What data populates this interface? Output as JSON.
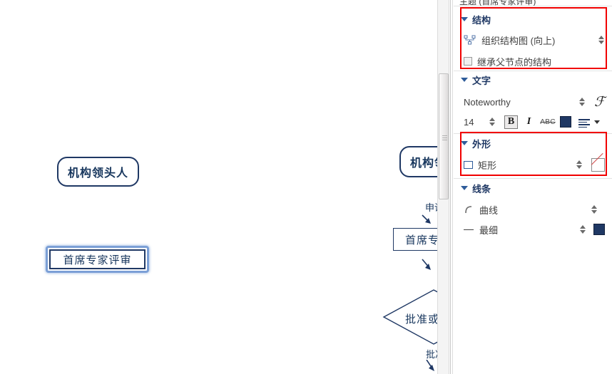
{
  "window": {
    "cut_off_header": "主题 (首席专家评审)"
  },
  "canvas": {
    "nodes": [
      {
        "id": "leader",
        "label": "机构领头人",
        "shape": "rounded-rect"
      },
      {
        "id": "leader2",
        "label": "机构领头人",
        "shape": "rounded-rect",
        "clipped": true
      },
      {
        "id": "chief-review-selected",
        "label": "首席专家评审",
        "shape": "rect",
        "selected": true
      },
      {
        "id": "chief-review",
        "label": "首席专家评审",
        "shape": "rect",
        "clipped": true
      },
      {
        "id": "approve",
        "label": "批准或驳回",
        "shape": "diamond",
        "clipped": true
      }
    ],
    "edge_labels": [
      {
        "id": "apply",
        "label": "申请"
      },
      {
        "id": "approve-result",
        "label": "批准"
      }
    ]
  },
  "scrollbar": {
    "name": "vertical-scrollbar",
    "orientation": "vertical"
  },
  "inspector": {
    "structure": {
      "title": "结构",
      "type_value": "组织结构图 (向上)",
      "type_icon": "org-chart-icon",
      "inherit_checkbox_label": "继承父节点的结构",
      "inherit_checked": false
    },
    "text": {
      "title": "文字",
      "font_family": "Noteworthy",
      "font_size": "14",
      "bold_label": "B",
      "italic_label": "I",
      "strike_label": "ABC",
      "color": "#1f3864",
      "bold_active": true,
      "fx_label": "ℱ"
    },
    "shape": {
      "title": "外形",
      "shape_value": "矩形",
      "fill": "none"
    },
    "line": {
      "title": "线条",
      "style_value": "曲线",
      "width_value": "最细",
      "color": "#1f3864"
    }
  },
  "highlights": [
    {
      "name": "structure-highlight"
    },
    {
      "name": "shape-highlight"
    }
  ],
  "colors": {
    "accent_navy": "#1f3864",
    "section_blue": "#1f3864",
    "highlight_red": "#f10000",
    "selection_blue": "#7b9fd6"
  }
}
